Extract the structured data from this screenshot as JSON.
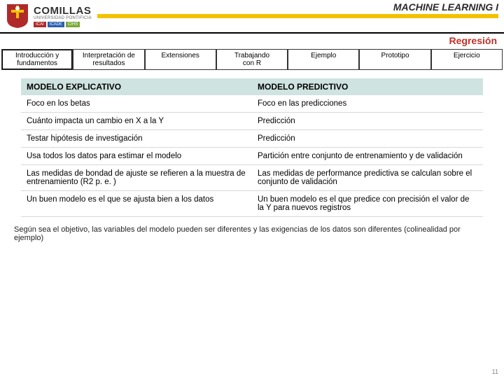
{
  "brand": {
    "name": "COMILLAS",
    "sub": "UNIVERSIDAD PONTIFICIA",
    "units": [
      "ICAI",
      "ICADE",
      "CIHS"
    ]
  },
  "course_title": "MACHINE LEARNING I",
  "section": "Regresión",
  "tabs": [
    {
      "l1": "Introducción y",
      "l2": "fundamentos"
    },
    {
      "l1": "Interpretación de",
      "l2": "resultados"
    },
    {
      "l1": "Extensiones",
      "l2": ""
    },
    {
      "l1": "Trabajando",
      "l2": "con R"
    },
    {
      "l1": "Ejemplo",
      "l2": ""
    },
    {
      "l1": "Prototipo",
      "l2": ""
    },
    {
      "l1": "Ejercicio",
      "l2": ""
    }
  ],
  "table": {
    "headers": [
      "MODELO EXPLICATIVO",
      "MODELO PREDICTIVO"
    ],
    "rows": [
      [
        "Foco en los betas",
        "Foco en las predicciones"
      ],
      [
        "Cuánto impacta un cambio en X a la Y",
        "Predicción"
      ],
      [
        "Testar hipótesis de investigación",
        "Predicción"
      ],
      [
        "Usa todos los datos para estimar el modelo",
        "Partición entre conjunto de entrenamiento y de validación"
      ],
      [
        "Las medidas de bondad de ajuste se refieren a la muestra de entrenamiento (R2 p. e. )",
        "Las medidas de performance predictiva se calculan sobre el conjunto de validación"
      ],
      [
        "Un buen modelo es el que se ajusta bien a los datos",
        "Un buen modelo es el que predice con precisión el valor de la Y para nuevos registros"
      ]
    ]
  },
  "footnote": "Según sea el objetivo, las variables del modelo pueden ser diferentes y las exigencias de los datos son diferentes (colinealidad por ejemplo)",
  "pagenum": "11"
}
